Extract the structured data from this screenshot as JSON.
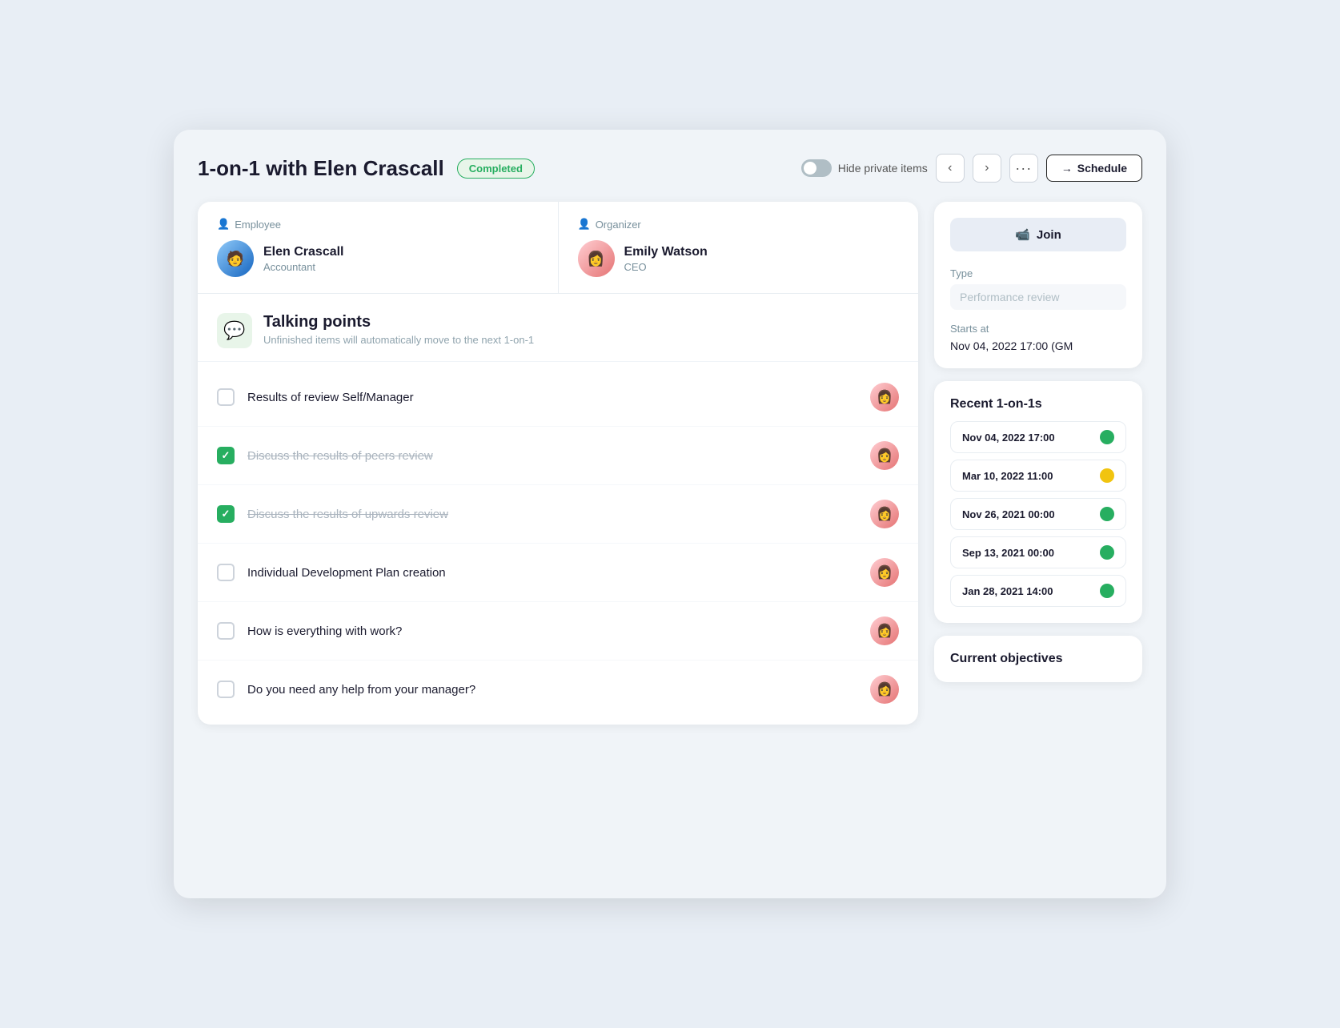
{
  "header": {
    "title": "1-on-1 with Elen Crascall",
    "status": "Completed",
    "hide_private": "Hide private items",
    "schedule_label": "Schedule"
  },
  "employee": {
    "role": "Employee",
    "name": "Elen Crascall",
    "title": "Accountant"
  },
  "organizer": {
    "role": "Organizer",
    "name": "Emily Watson",
    "title": "CEO"
  },
  "talking_points": {
    "title": "Talking points",
    "subtitle": "Unfinished items will automatically move to the next 1-on-1"
  },
  "agenda_items": [
    {
      "id": 1,
      "text": "Results of review Self/Manager",
      "checked": false
    },
    {
      "id": 2,
      "text": "Discuss the results of peers review",
      "checked": true
    },
    {
      "id": 3,
      "text": "Discuss the results of upwards review",
      "checked": true
    },
    {
      "id": 4,
      "text": "Individual Development Plan creation",
      "checked": false
    },
    {
      "id": 5,
      "text": "How is everything with work?",
      "checked": false
    },
    {
      "id": 6,
      "text": "Do you need any help from your manager?",
      "checked": false
    }
  ],
  "right_panel": {
    "join_label": "Join",
    "type_label": "Type",
    "type_value": "Performance review",
    "starts_label": "Starts at",
    "starts_value": "Nov 04, 2022 17:00 (GM"
  },
  "recent_1on1s": {
    "title": "Recent 1-on-1s",
    "items": [
      {
        "date": "Nov 04, 2022 17:00",
        "status": "green"
      },
      {
        "date": "Mar 10, 2022 11:00",
        "status": "yellow"
      },
      {
        "date": "Nov 26, 2021 00:00",
        "status": "green"
      },
      {
        "date": "Sep 13, 2021 00:00",
        "status": "green"
      },
      {
        "date": "Jan 28, 2021 14:00",
        "status": "green"
      }
    ]
  },
  "current_objectives": {
    "title": "Current objectives"
  }
}
